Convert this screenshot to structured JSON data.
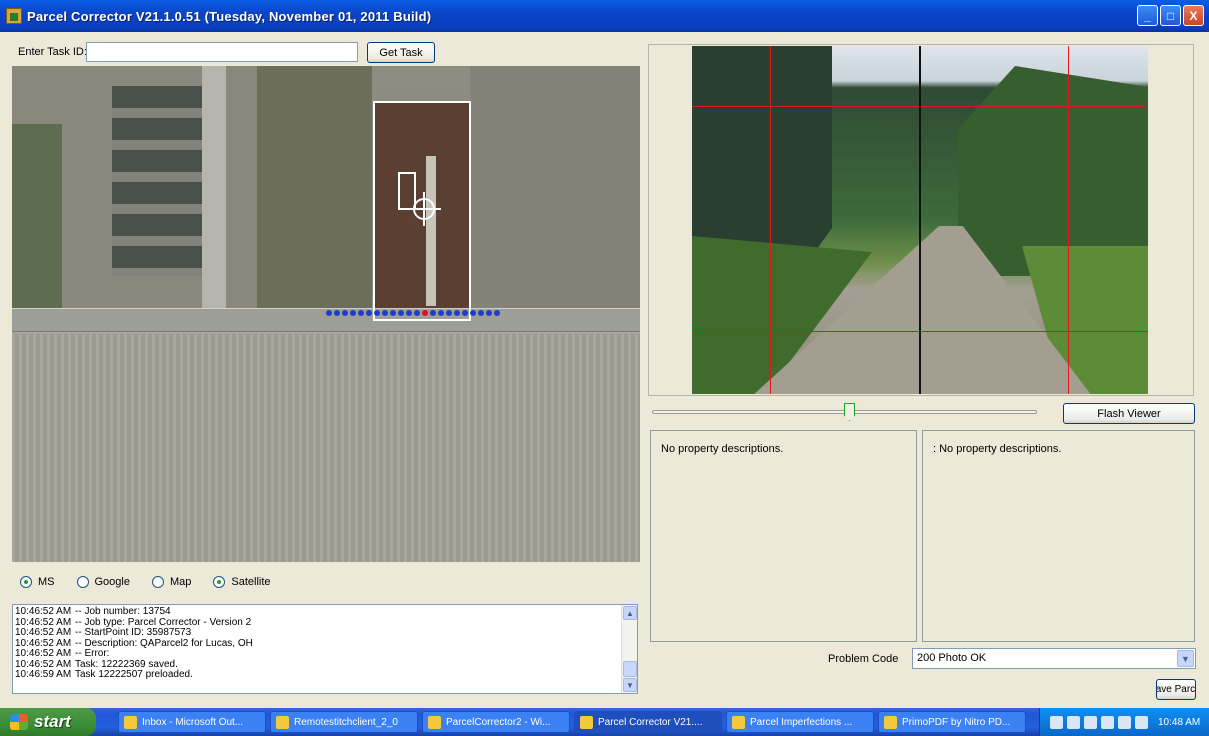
{
  "window": {
    "title": "Parcel Corrector V21.1.0.51 (Tuesday, November 01, 2011 Build)",
    "buttons": {
      "minimize": "_",
      "restore": "□",
      "close": "X"
    }
  },
  "task": {
    "label": "Enter Task ID:",
    "value": "",
    "get_task_label": "Get Task"
  },
  "map_options": [
    {
      "label": "MS",
      "checked": true
    },
    {
      "label": "Google",
      "checked": false
    },
    {
      "label": "Map",
      "checked": false
    },
    {
      "label": "Satellite",
      "checked": true
    }
  ],
  "log": [
    {
      "time": "10:46:52 AM",
      "text": "-- Job number: 13754"
    },
    {
      "time": "10:46:52 AM",
      "text": "-- Job type: Parcel Corrector - Version 2"
    },
    {
      "time": "10:46:52 AM",
      "text": "-- StartPoint ID: 35987573"
    },
    {
      "time": "10:46:52 AM",
      "text": "-- Description: QAParcel2 for Lucas, OH"
    },
    {
      "time": "10:46:52 AM",
      "text": "-- Error:"
    },
    {
      "time": "10:46:52 AM",
      "text": "Task: 12222369 saved."
    },
    {
      "time": "10:46:59 AM",
      "text": "Task 12222507 preloaded."
    }
  ],
  "viewer": {
    "flash_viewer_label": "Flash Viewer",
    "slider_position": 0.5
  },
  "descriptions": {
    "left": "No property descriptions.",
    "right": ": No property descriptions."
  },
  "problem_code": {
    "label": "Problem Code",
    "value": "200 Photo OK"
  },
  "save_parcel_label": "Save Parcel",
  "taskbar": {
    "start_label": "start",
    "items": [
      {
        "label": "Inbox - Microsoft Out...",
        "active": false
      },
      {
        "label": "Remotestitchclient_2_0",
        "active": false
      },
      {
        "label": "ParcelCorrector2 - Wi...",
        "active": false
      },
      {
        "label": "Parcel Corrector V21....",
        "active": true
      },
      {
        "label": "Parcel Imperfections ...",
        "active": false
      },
      {
        "label": "PrimoPDF by Nitro PD...",
        "active": false
      }
    ],
    "clock": "10:48 AM"
  },
  "colors": {
    "titlebar": "#0a5de3",
    "grid_lines": "#e01818",
    "parcel_outline": "#ffffff",
    "start_button": "#3c8d37"
  }
}
